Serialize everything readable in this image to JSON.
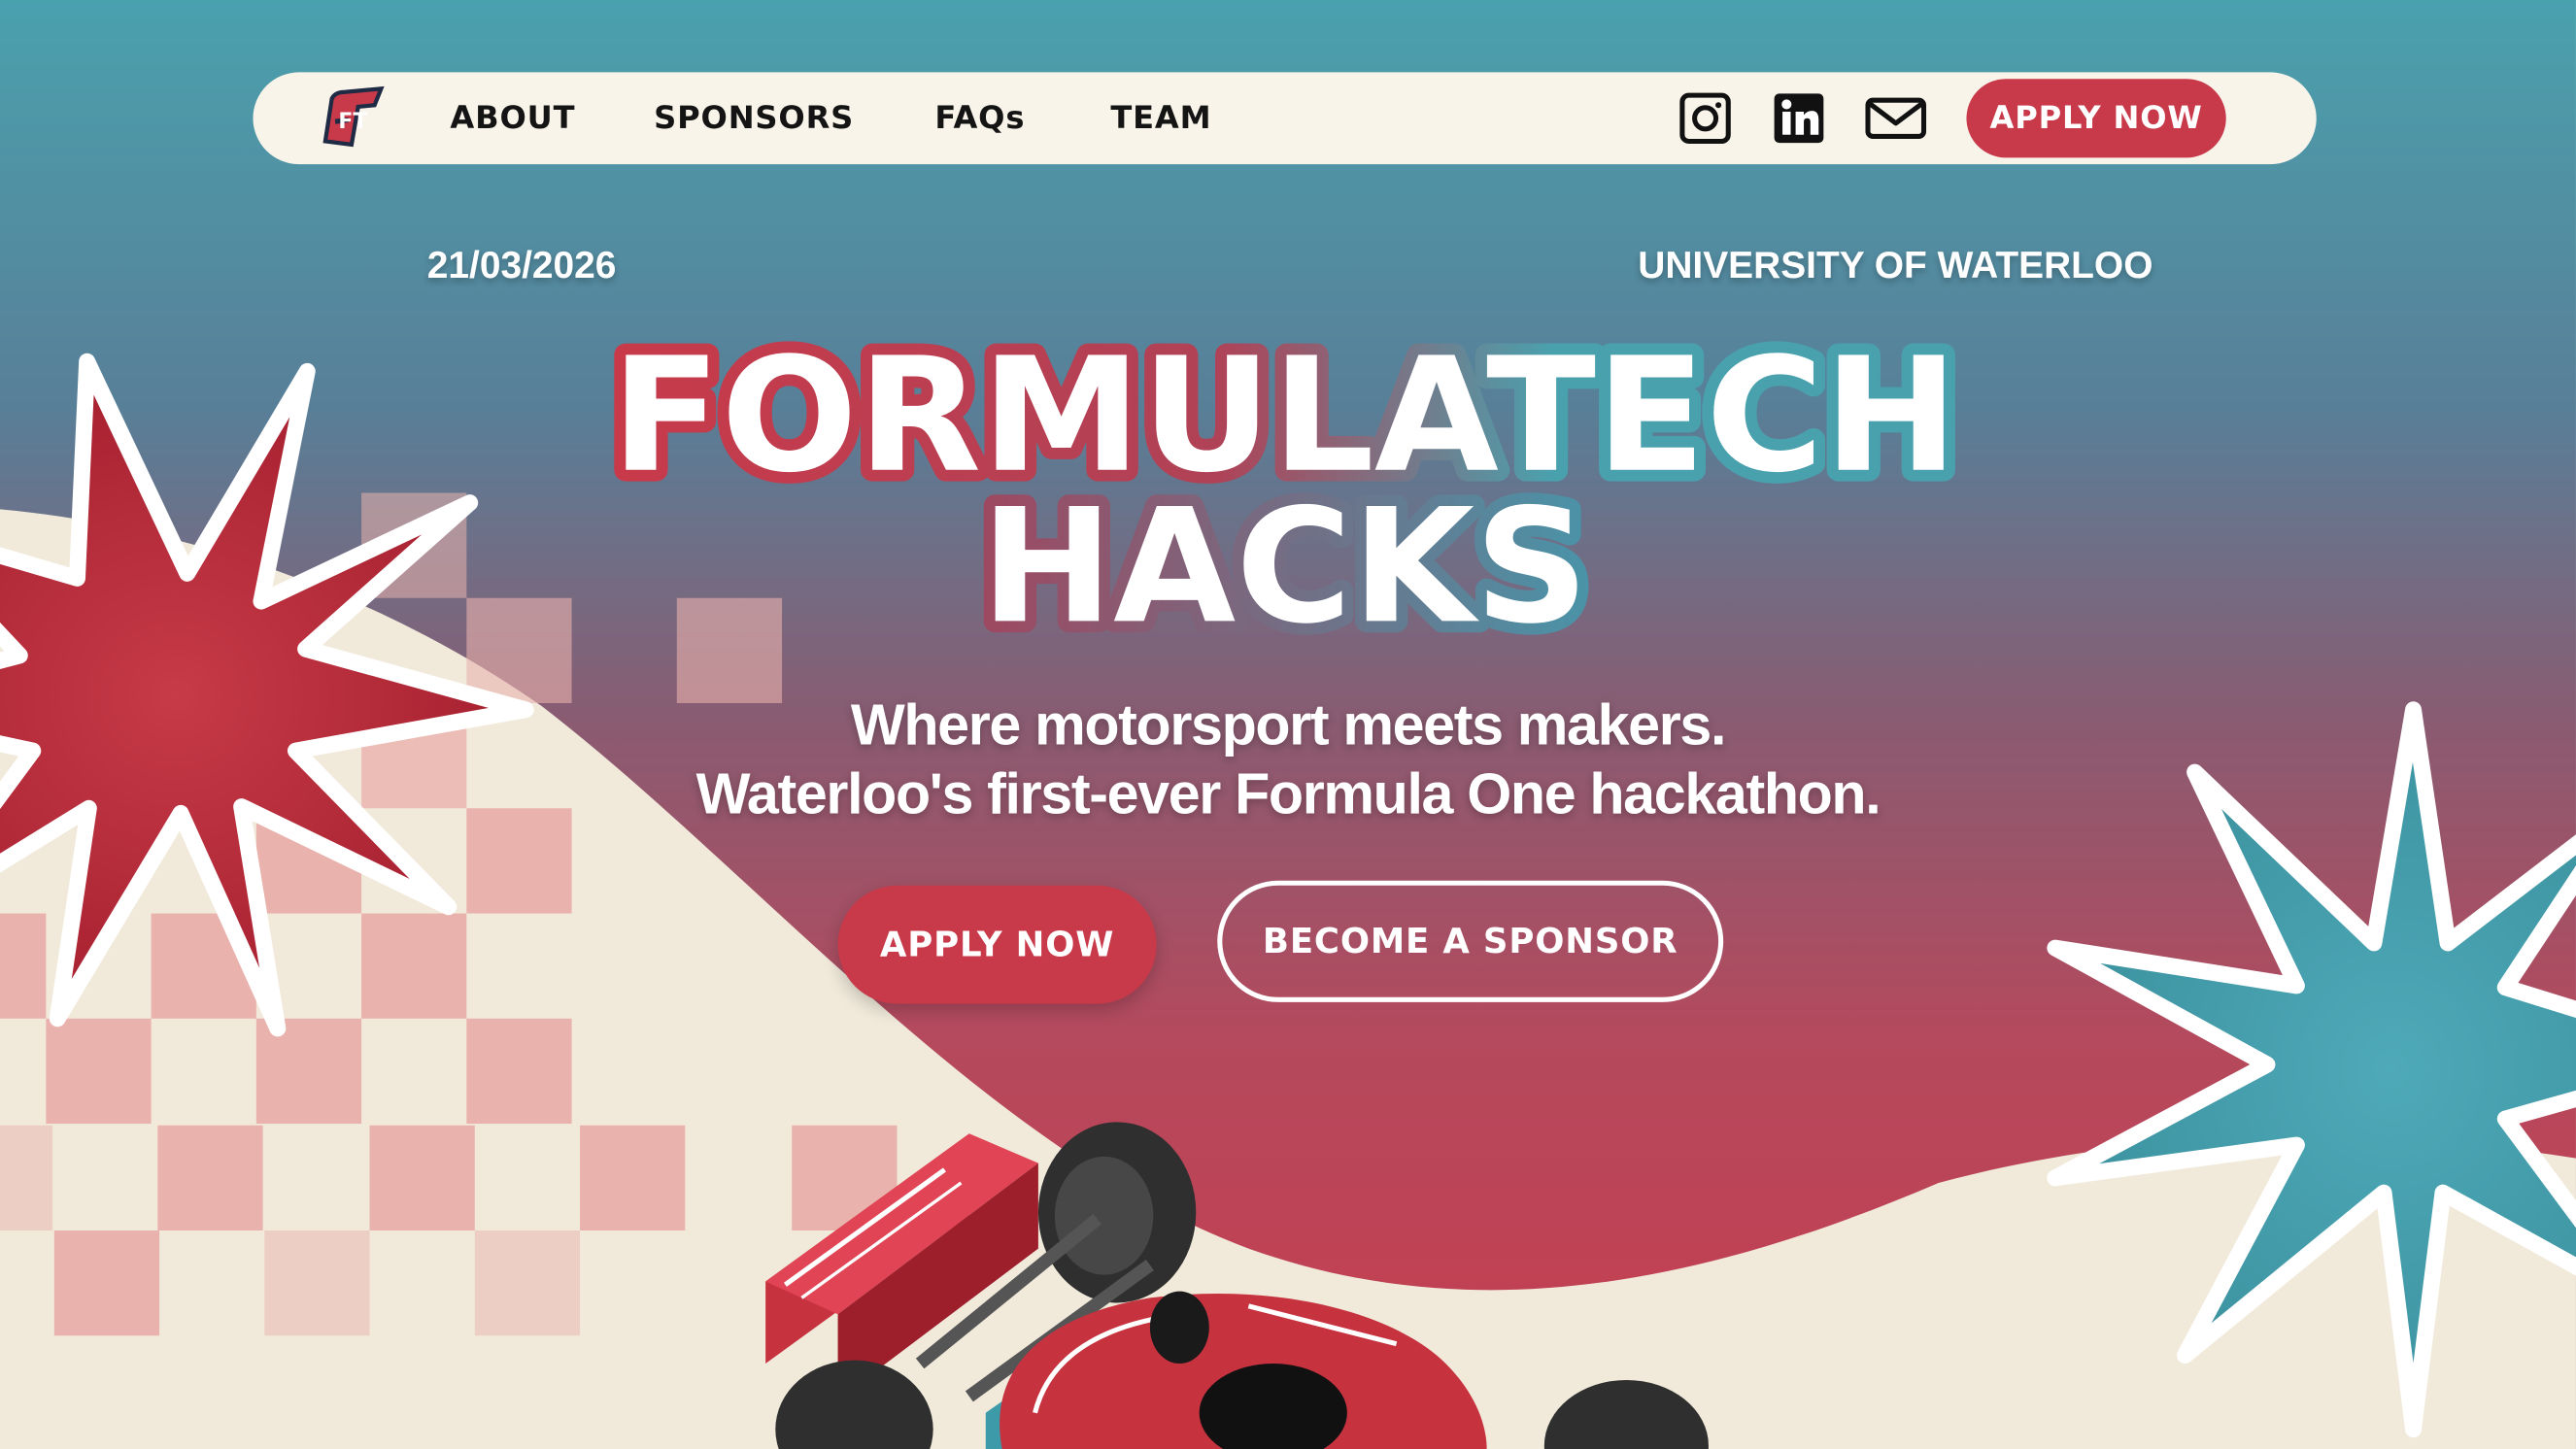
{
  "nav": {
    "links": [
      "ABOUT",
      "SPONSORS",
      "FAQs",
      "TEAM"
    ],
    "apply_label": "APPLY NOW",
    "logo_text": "FT"
  },
  "event": {
    "date": "21/03/2026",
    "location": "UNIVERSITY OF WATERLOO"
  },
  "hero": {
    "title_line1": "FORMULATECH",
    "title_line2": "HACKS",
    "tagline_line1": "Where motorsport meets makers.",
    "tagline_line2": "Waterloo's first-ever Formula One hackathon.",
    "apply_label": "APPLY NOW",
    "sponsor_label": "BECOME A SPONSOR"
  },
  "colors": {
    "brand_red": "#c83a4a",
    "brand_teal": "#4aa1ae",
    "cream": "#f9f4ea",
    "check_pink": "#eab2ad"
  },
  "icons": [
    "instagram-icon",
    "linkedin-icon",
    "mail-icon",
    "red-starburst",
    "teal-starburst",
    "race-car"
  ]
}
